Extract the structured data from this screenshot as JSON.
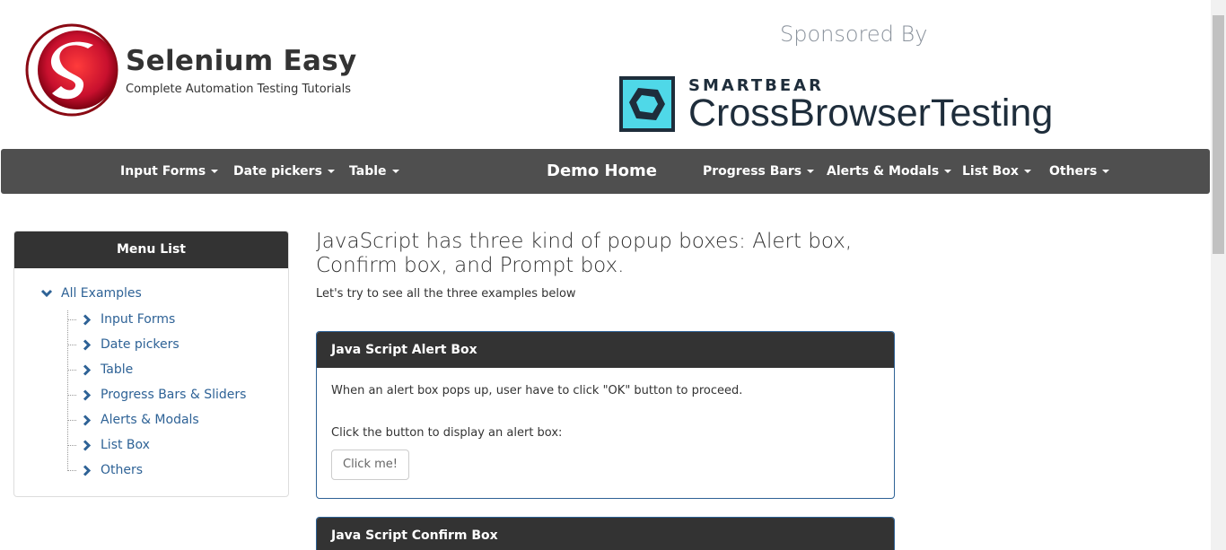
{
  "header": {
    "brand_title": "Selenium Easy",
    "brand_subtitle": "Complete Automation Testing Tutorials",
    "sponsor_text": "Sponsored By",
    "sponsor_smartbear": "SMARTBEAR",
    "sponsor_product": "CrossBrowserTesting"
  },
  "navbar": {
    "items": [
      {
        "label": "Input Forms"
      },
      {
        "label": "Date pickers"
      },
      {
        "label": "Table"
      },
      {
        "label": "Demo Home"
      },
      {
        "label": "Progress Bars"
      },
      {
        "label": "Alerts & Modals"
      },
      {
        "label": "List Box"
      },
      {
        "label": "Others"
      }
    ]
  },
  "sidebar": {
    "title": "Menu List",
    "root": "All Examples",
    "items": [
      {
        "label": "Input Forms"
      },
      {
        "label": "Date pickers"
      },
      {
        "label": "Table"
      },
      {
        "label": "Progress Bars & Sliders"
      },
      {
        "label": "Alerts & Modals"
      },
      {
        "label": "List Box"
      },
      {
        "label": "Others"
      }
    ]
  },
  "main": {
    "heading": "JavaScript has three kind of popup boxes: Alert box, Confirm box, and Prompt box.",
    "subheading": "Let's try to see all the three examples below",
    "alert_panel": {
      "title": "Java Script Alert Box",
      "text1": "When an alert box pops up, user have to click \"OK\" button to proceed.",
      "text2": "Click the button to display an alert box:",
      "button": "Click me!"
    },
    "confirm_panel": {
      "title": "Java Script Confirm Box"
    }
  },
  "colors": {
    "navbar": "#4f4f4f",
    "panel_header": "#333333",
    "link": "#2e6296",
    "logo_red": "#c8102e",
    "smartbear_cyan": "#4fd8e8"
  }
}
